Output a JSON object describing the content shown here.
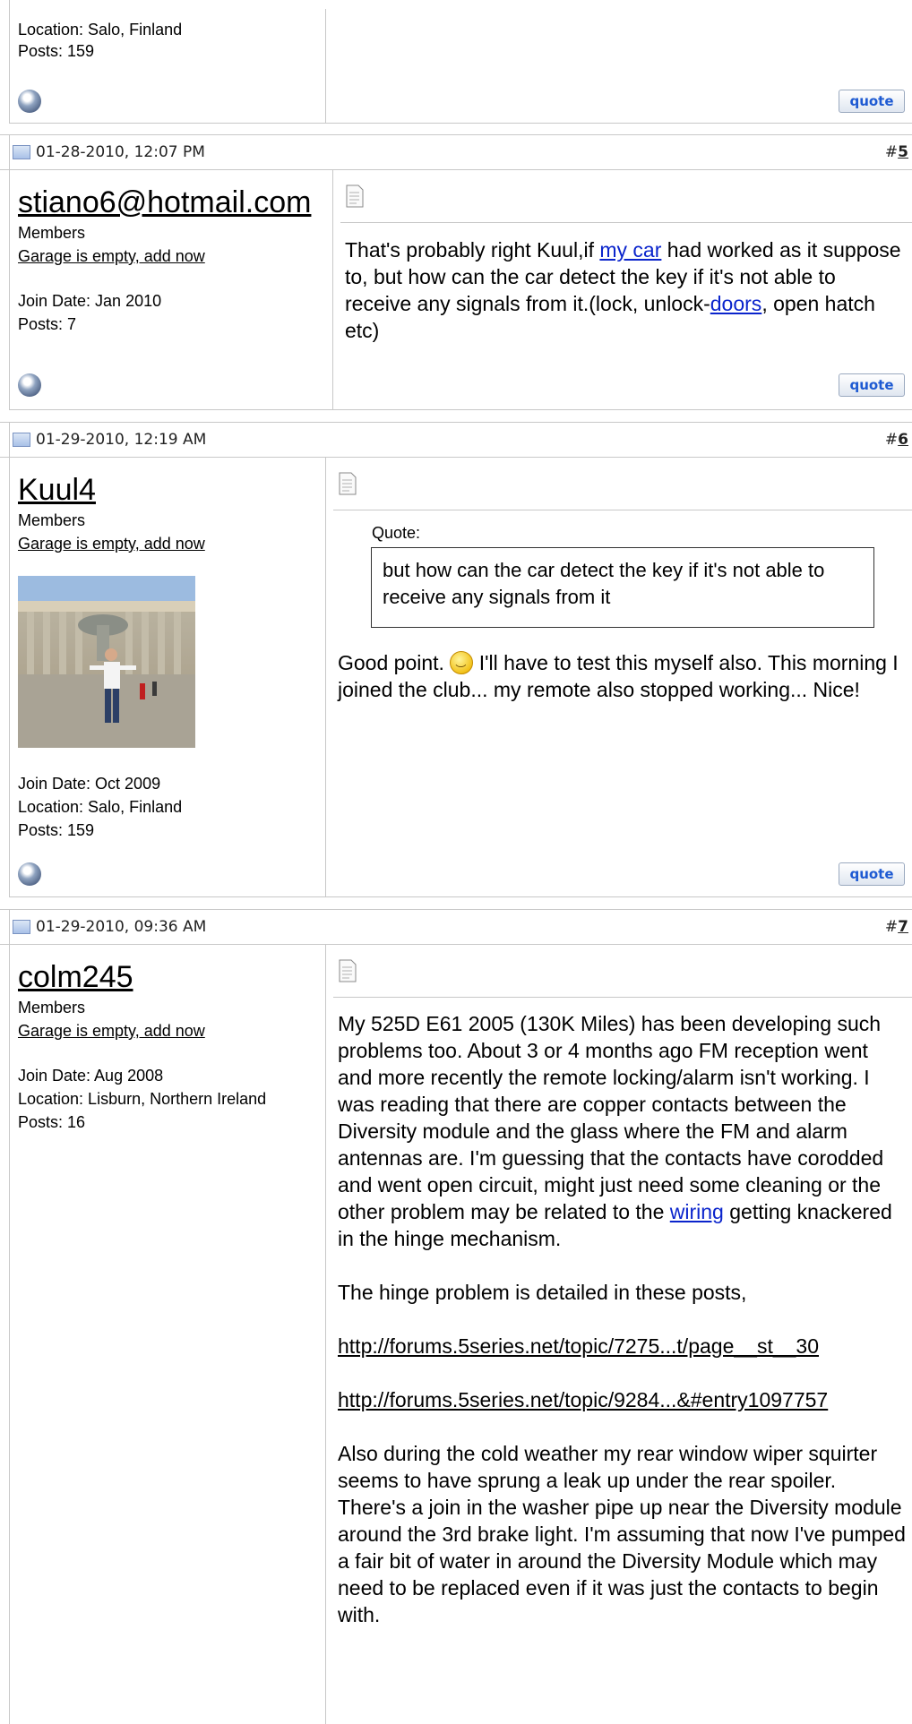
{
  "post4_tail": {
    "location": "Location: Salo, Finland",
    "posts": "Posts: 159",
    "quote_label": "quote"
  },
  "posts": [
    {
      "date": "01-28-2010, 12:07 PM",
      "hash": "#",
      "number": "5",
      "username": "stiano6@hotmail.com",
      "group": "Members",
      "garage": "Garage is empty, add now",
      "join": "Join Date: Jan 2010",
      "posts": "Posts: 7",
      "msg_a": "That's probably right Kuul,if ",
      "msg_link1": "my car",
      "msg_b": " had worked as it suppose to, but how can the car detect the key if it's not able to receive any signals from it.(lock, unlock-",
      "msg_link2": "doors",
      "msg_c": ", open hatch etc)",
      "quote_label": "quote"
    },
    {
      "date": "01-29-2010, 12:19 AM",
      "hash": "#",
      "number": "6",
      "username": "Kuul4",
      "group": "Members",
      "garage": "Garage is empty, add now",
      "join": "Join Date: Oct 2009",
      "location": "Location: Salo, Finland",
      "posts": "Posts: 159",
      "quote_caption": "Quote:",
      "quote_text": "but how can the car detect the key if it's not able to receive any signals from it",
      "msg_a": "Good point. ",
      "msg_b": " I'll have to test this myself also. This morning I joined the club... my remote also stopped working... Nice!",
      "quote_label": "quote"
    },
    {
      "date": "01-29-2010, 09:36 AM",
      "hash": "#",
      "number": "7",
      "username": "colm245",
      "group": "Members",
      "garage": "Garage is empty, add now",
      "join": "Join Date: Aug 2008",
      "location": "Location: Lisburn, Northern Ireland",
      "posts": "Posts: 16",
      "p1_a": "My 525D E61 2005 (130K Miles) has been developing such problems too. About 3 or 4 months ago FM reception went and more recently the remote locking/alarm isn't working. I was reading that there are copper contacts between the Diversity module and the glass where the FM and alarm antennas are. I'm guessing that the contacts have corodded and went open circuit, might just need some cleaning or the other problem may be related to the ",
      "p1_link": "wiring",
      "p1_b": " getting knackered in the hinge mechanism.",
      "p2": "The hinge problem is detailed in these posts,",
      "url1": "http://forums.5series.net/topic/7275...t/page__st__30",
      "url2": "http://forums.5series.net/topic/9284...&#entry1097757",
      "p3": "Also during the cold weather my rear window wiper squirter seems to have sprung a leak up under the rear spoiler. There's a join in the washer pipe up near the Diversity module around the 3rd brake light. I'm assuming that now I've pumped a fair bit of water in around the Diversity Module which may need to be replaced even if it was just the contacts to begin with."
    }
  ]
}
